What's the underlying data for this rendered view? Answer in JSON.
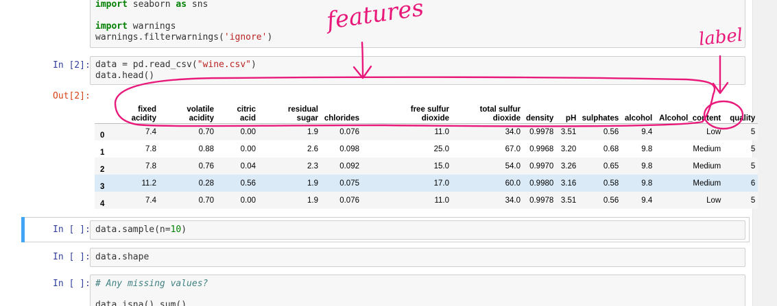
{
  "cells": [
    {
      "prompt": "",
      "lines": [
        [
          "kw",
          "import"
        ],
        [
          "",
          "seaborn"
        ],
        [
          "kw",
          "as"
        ],
        [
          "",
          "sns"
        ]
      ]
    },
    {
      "prompt": "In [2]:"
    },
    {
      "prompt": "In [ ]:",
      "code": "data.sample(n=10)"
    },
    {
      "prompt": "In [ ]:",
      "code": "data.shape"
    },
    {
      "prompt": "In [ ]:",
      "comment": "# Any missing values?",
      "code_partial": "data.isna().sum()"
    }
  ],
  "cell0": {
    "line1_kw": "import",
    "line1_rest": " seaborn ",
    "line1_kw2": "as",
    "line1_end": " sns",
    "line2_kw": "import",
    "line2_rest": " warnings",
    "line3_a": "warnings.filterwarnings(",
    "line3_str": "'ignore'",
    "line3_b": ")"
  },
  "cell2": {
    "prompt": "In [2]:",
    "line1_a": "data = pd.read_csv(",
    "line1_str": "\"wine.csv\"",
    "line1_b": ")",
    "line2": "data.head()",
    "out_prompt": "Out[2]:"
  },
  "cell3": {
    "prompt": "In [ ]:",
    "code_a": "data.sample(n=",
    "code_num": "10",
    "code_b": ")"
  },
  "cell4": {
    "prompt": "In [ ]:",
    "code": "data.shape"
  },
  "cell5": {
    "prompt": "In [ ]:",
    "comment": "# Any missing values?",
    "code": "data.isna().sum()"
  },
  "table": {
    "columns": [
      {
        "l1": "fixed",
        "l2": "acidity"
      },
      {
        "l1": "volatile",
        "l2": "acidity"
      },
      {
        "l1": "citric",
        "l2": "acid"
      },
      {
        "l1": "residual",
        "l2": "sugar"
      },
      {
        "l1": "",
        "l2": "chlorides"
      },
      {
        "l1": "free sulfur",
        "l2": "dioxide"
      },
      {
        "l1": "total sulfur",
        "l2": "dioxide"
      },
      {
        "l1": "",
        "l2": "density"
      },
      {
        "l1": "",
        "l2": "pH"
      },
      {
        "l1": "",
        "l2": "sulphates"
      },
      {
        "l1": "",
        "l2": "alcohol"
      },
      {
        "l1": "",
        "l2": "Alcohol_content"
      },
      {
        "l1": "",
        "l2": "quality"
      }
    ],
    "rows": [
      {
        "index": "0",
        "values": [
          "7.4",
          "0.70",
          "0.00",
          "1.9",
          "0.076",
          "11.0",
          "34.0",
          "0.9978",
          "3.51",
          "0.56",
          "9.4",
          "Low",
          "5"
        ]
      },
      {
        "index": "1",
        "values": [
          "7.8",
          "0.88",
          "0.00",
          "2.6",
          "0.098",
          "25.0",
          "67.0",
          "0.9968",
          "3.20",
          "0.68",
          "9.8",
          "Medium",
          "5"
        ]
      },
      {
        "index": "2",
        "values": [
          "7.8",
          "0.76",
          "0.04",
          "2.3",
          "0.092",
          "15.0",
          "54.0",
          "0.9970",
          "3.26",
          "0.65",
          "9.8",
          "Medium",
          "5"
        ]
      },
      {
        "index": "3",
        "values": [
          "11.2",
          "0.28",
          "0.56",
          "1.9",
          "0.075",
          "17.0",
          "60.0",
          "0.9980",
          "3.16",
          "0.58",
          "9.8",
          "Medium",
          "6"
        ]
      },
      {
        "index": "4",
        "values": [
          "7.4",
          "0.70",
          "0.00",
          "1.9",
          "0.076",
          "11.0",
          "34.0",
          "0.9978",
          "3.51",
          "0.56",
          "9.4",
          "Low",
          "5"
        ]
      }
    ]
  },
  "annotations": {
    "features": "features",
    "label": "label",
    "ink_color": "#e8197a"
  }
}
